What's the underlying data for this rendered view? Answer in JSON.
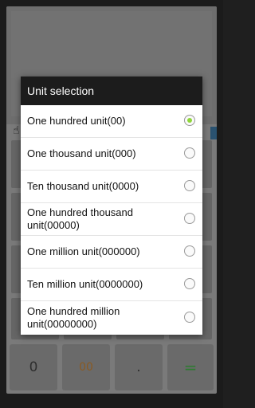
{
  "dialog": {
    "title": "Unit selection",
    "options": [
      {
        "label": "One hundred unit(00)",
        "selected": true
      },
      {
        "label": "One thousand unit(000)",
        "selected": false
      },
      {
        "label": "Ten thousand unit(0000)",
        "selected": false
      },
      {
        "label": "One hundred thousand unit(00000)",
        "selected": false
      },
      {
        "label": "One million unit(000000)",
        "selected": false
      },
      {
        "label": "Ten million unit(0000000)",
        "selected": false
      },
      {
        "label": "One hundred million unit(00000000)",
        "selected": false
      }
    ]
  },
  "keypad": {
    "bottom_row": [
      {
        "label": "0",
        "color": "#2e2e2e"
      },
      {
        "label": "00",
        "color": "#8a5a22"
      },
      {
        "label": ".",
        "color": "#2e2e2e"
      },
      {
        "label": "=",
        "color": "#2f7a32"
      }
    ]
  },
  "colors": {
    "accent_selected": "#8fd63a",
    "dialog_header": "#1c1c1c"
  },
  "icons": {
    "hand": "hand-pointer-icon"
  }
}
